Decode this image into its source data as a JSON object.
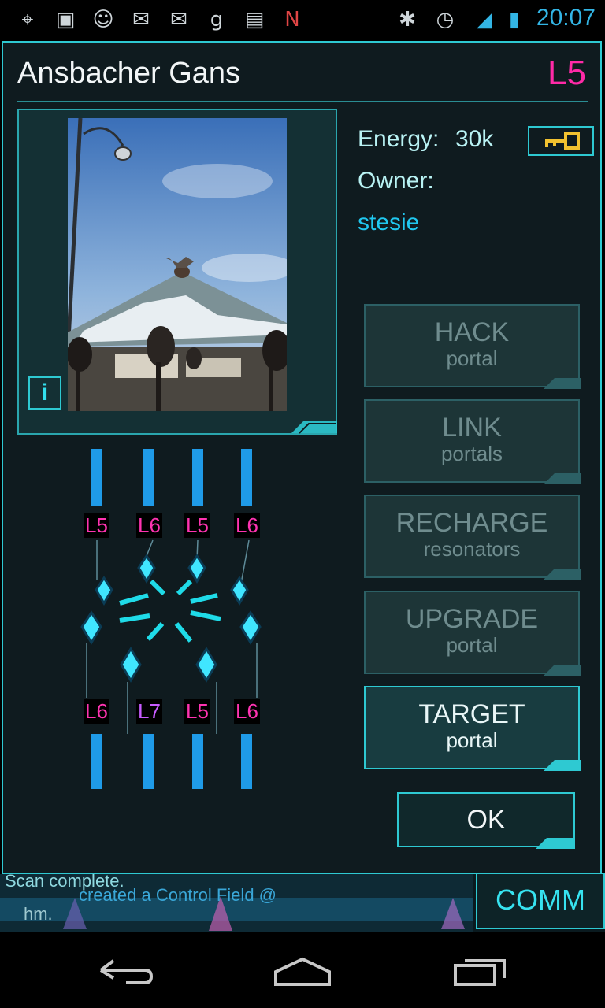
{
  "status_bar": {
    "time": "20:07",
    "icons": [
      "gps-icon",
      "gallery-icon",
      "talk-icon",
      "gmail-icon",
      "gmail-icon",
      "gplus-icon",
      "chat-icon",
      "android-n-icon",
      "bluetooth-icon",
      "alarm-icon",
      "signal-icon",
      "battery-icon"
    ]
  },
  "portal": {
    "name": "Ansbacher Gans",
    "level": "L5",
    "energy_label": "Energy:",
    "energy_value": "30k",
    "owner_label": "Owner:",
    "owner_name": "stesie",
    "info_label": "i"
  },
  "resonators": {
    "top": [
      "L5",
      "L6",
      "L5",
      "L6"
    ],
    "bottom": [
      "L6",
      "L7",
      "L5",
      "L6"
    ]
  },
  "actions": [
    {
      "main": "HACK",
      "sub": "portal",
      "enabled": false
    },
    {
      "main": "LINK",
      "sub": "portals",
      "enabled": false
    },
    {
      "main": "RECHARGE",
      "sub": "resonators",
      "enabled": false
    },
    {
      "main": "UPGRADE",
      "sub": "portal",
      "enabled": false
    },
    {
      "main": "TARGET",
      "sub": "portal",
      "enabled": true
    }
  ],
  "ok_label": "OK",
  "comm": {
    "label": "COMM",
    "lines": [
      "Scan complete.",
      "created a Control Field @",
      "hm."
    ]
  },
  "colors": {
    "accent": "#2ec9d2",
    "level": "#ff2aa7",
    "owner": "#20c8f0"
  }
}
